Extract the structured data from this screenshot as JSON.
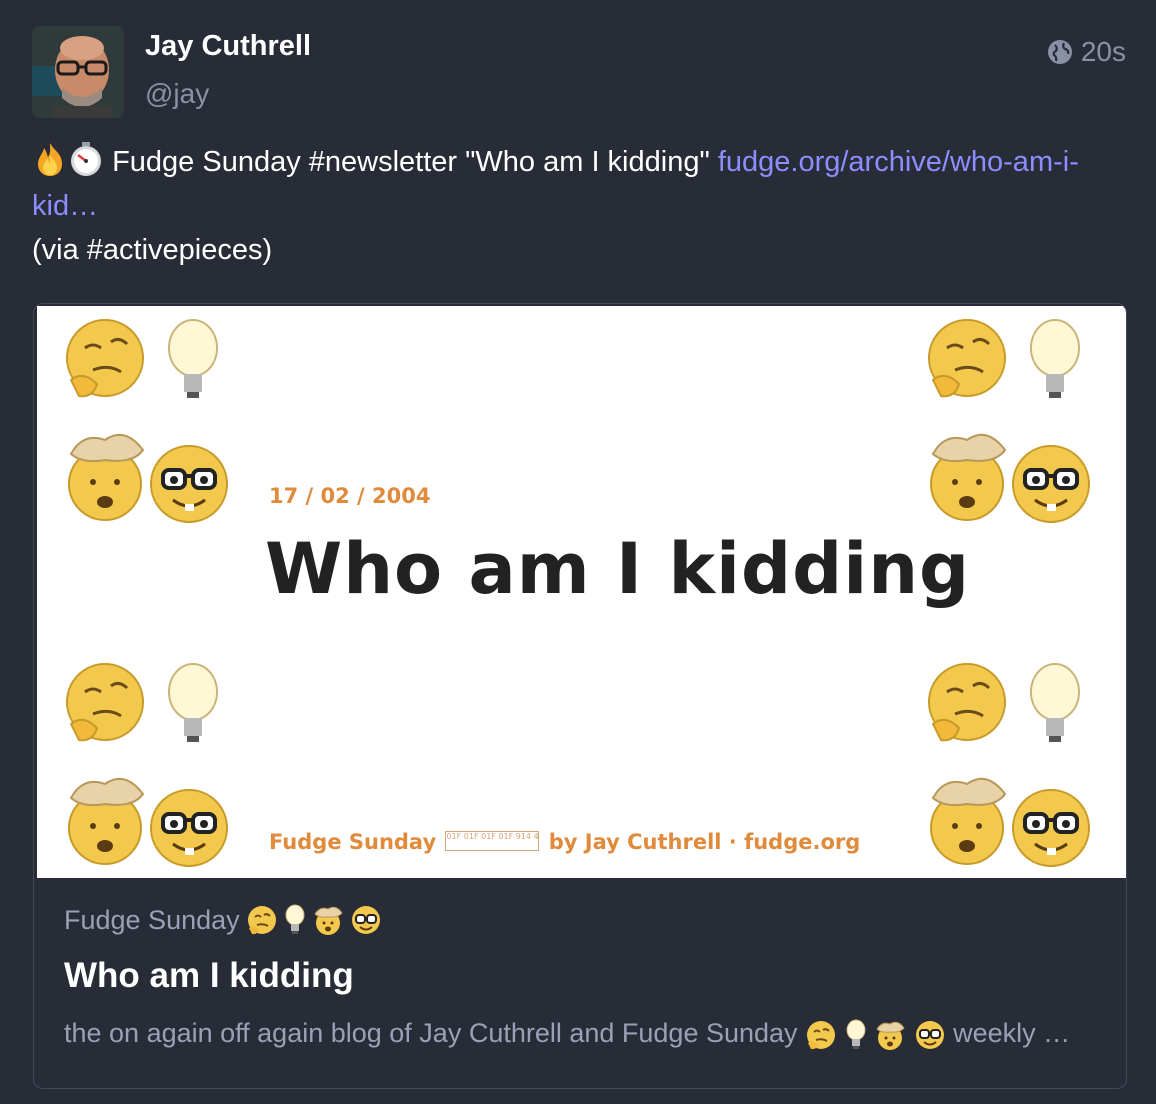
{
  "author": {
    "display_name": "Jay Cuthrell",
    "handle": "@jay"
  },
  "timestamp": {
    "icon": "globe-icon",
    "value": "20s"
  },
  "status": {
    "text_main": "Fudge Sunday #newsletter \"Who am I kidding\"",
    "link_text_line1": "fudge.org/archive/who-am-i-",
    "link_text_line2": "kid…",
    "via_text": "(via #activepieces)",
    "leading_emojis": [
      "fire-icon",
      "stopwatch-icon"
    ]
  },
  "card": {
    "image": {
      "date": "17 / 02 / 2004",
      "headline": "Who am I kidding",
      "footer_pre": "Fudge Sunday",
      "footer_glyphs": "01F 01F 01F 01F 914 4A1 92F 913",
      "footer_post": "by Jay Cuthrell · fudge.org"
    },
    "provider": "Fudge Sunday",
    "title": "Who am I kidding",
    "description_pre": "the on again off again blog of Jay Cuthrell and Fudge Sunday",
    "description_post": "weekly …"
  }
}
